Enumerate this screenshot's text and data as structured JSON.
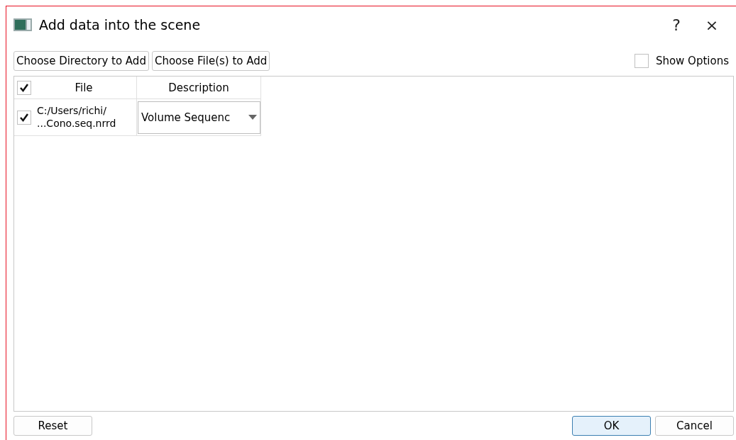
{
  "window": {
    "title": "Add data into the scene",
    "help": "?",
    "close": "×"
  },
  "toolbar": {
    "buttons": [
      "Choose Directory to Add",
      "Choose File(s) to Add"
    ],
    "show_options": {
      "label": "Show Options",
      "checked": false
    }
  },
  "table": {
    "header": {
      "checked": true,
      "columns": [
        "File",
        "Description"
      ]
    },
    "rows": [
      {
        "checked": true,
        "file": "C:/Users/richi/\n...Cono.seq.nrrd",
        "description": "Volume Sequenc"
      }
    ]
  },
  "footer": {
    "left": [
      "Reset"
    ],
    "right": [
      {
        "label": "OK",
        "default": true
      },
      {
        "label": "Cancel",
        "default": false
      }
    ]
  }
}
